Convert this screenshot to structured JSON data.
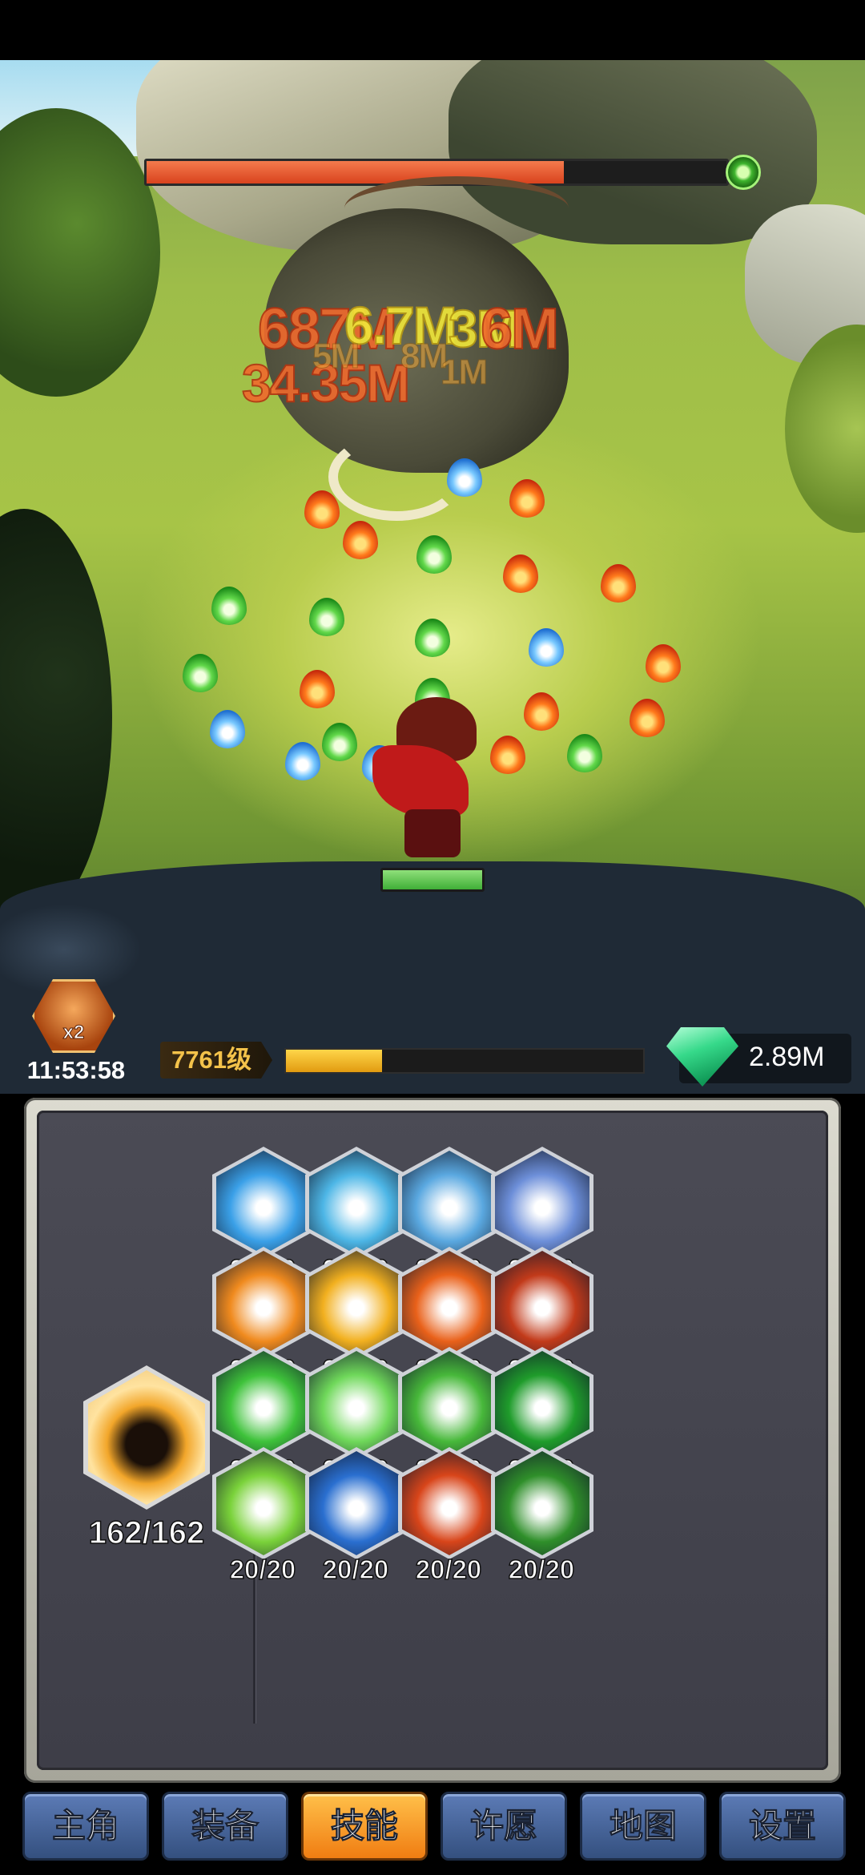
{
  "battle": {
    "boss_hp_fraction": 0.72,
    "hero_hp_fraction": 1.0,
    "damage_numbers": [
      "687M",
      "6.7M",
      "3M",
      "6M",
      "34.35M",
      "5M",
      "8M",
      "1M"
    ]
  },
  "status": {
    "boost_label": "x2",
    "boost_timer": "11:53:58",
    "level_label": "7761级",
    "level_progress_fraction": 0.27,
    "gems": "2.89M"
  },
  "skills": {
    "ultimate": {
      "icon": "shadow-flame-icon",
      "count": "162/162"
    },
    "items": [
      {
        "icon": "ice-burst-icon",
        "count": "20/20",
        "color": "#3aa0e8"
      },
      {
        "icon": "tornado-icon",
        "count": "20/20",
        "color": "#4db6e6"
      },
      {
        "icon": "ice-wave-icon",
        "count": "20/20",
        "color": "#5aa8e0"
      },
      {
        "icon": "ice-shard-icon",
        "count": "20/20",
        "color": "#6d8fd9"
      },
      {
        "icon": "fire-pillar-icon",
        "count": "20/20",
        "color": "#f08a1e"
      },
      {
        "icon": "fire-ball-icon",
        "count": "20/20",
        "color": "#f2b01f"
      },
      {
        "icon": "fire-burst-icon",
        "count": "20/20",
        "color": "#e9611a"
      },
      {
        "icon": "fire-ring-icon",
        "count": "20/20",
        "color": "#c23a1a"
      },
      {
        "icon": "wind-slash-icon",
        "count": "20/20",
        "color": "#3ec23a"
      },
      {
        "icon": "lightning-green-icon",
        "count": "20/20",
        "color": "#6fd85a"
      },
      {
        "icon": "wind-spiral-icon",
        "count": "20/20",
        "color": "#47b83a"
      },
      {
        "icon": "pentagram-icon",
        "count": "20/20",
        "color": "#1f9c2b"
      },
      {
        "icon": "heart-heal-icon",
        "count": "20/20",
        "color": "#7ad23a"
      },
      {
        "icon": "water-vortex-icon",
        "count": "20/20",
        "color": "#2a6fd0"
      },
      {
        "icon": "flame-wall-icon",
        "count": "20/20",
        "color": "#d8451a"
      },
      {
        "icon": "thorn-vines-icon",
        "count": "20/20",
        "color": "#2f8f2a"
      }
    ]
  },
  "nav": [
    {
      "label": "主角",
      "active": false
    },
    {
      "label": "装备",
      "active": false
    },
    {
      "label": "技能",
      "active": true
    },
    {
      "label": "许愿",
      "active": false
    },
    {
      "label": "地图",
      "active": false
    },
    {
      "label": "设置",
      "active": false
    }
  ]
}
